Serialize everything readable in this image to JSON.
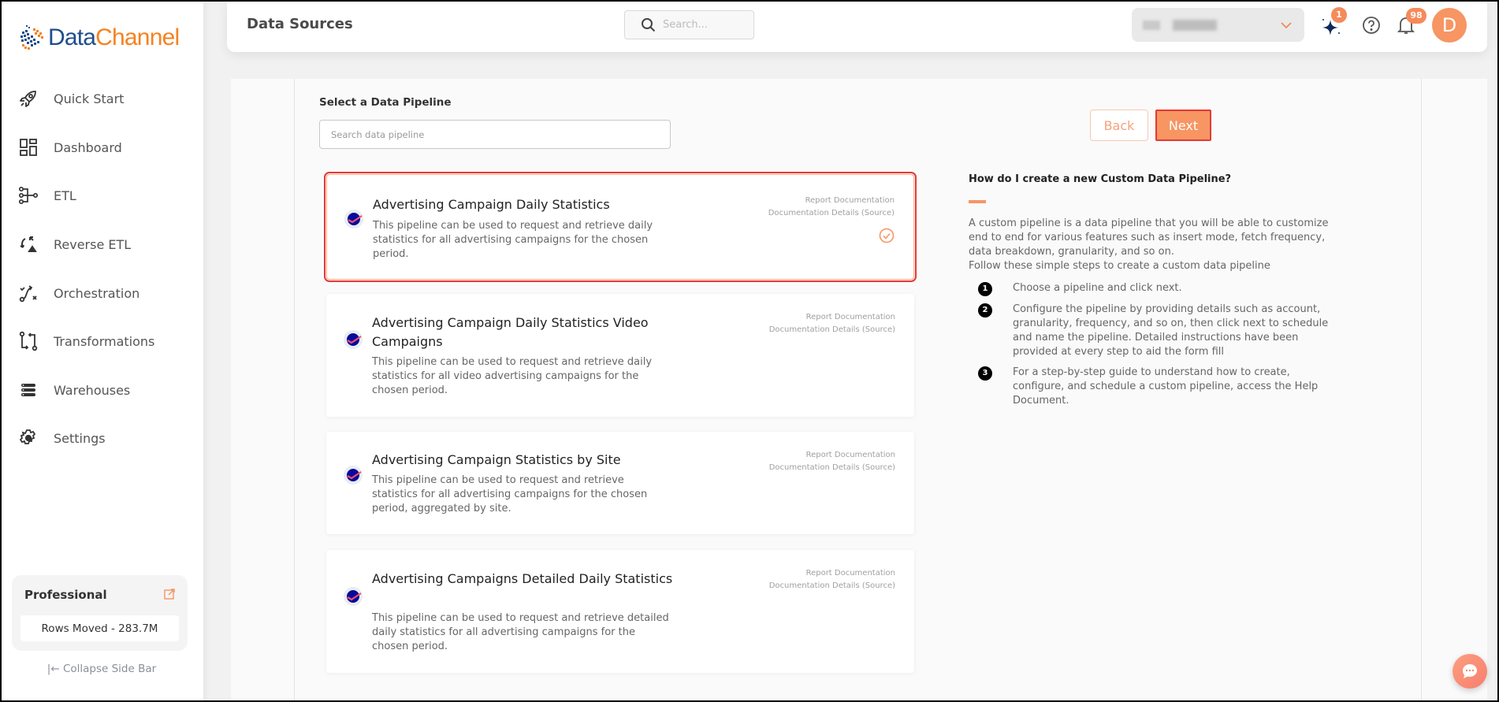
{
  "brand": {
    "name_part1": "Data",
    "name_part2": "Channel"
  },
  "sidebar": {
    "items": [
      {
        "label": "Quick Start",
        "icon": "rocket-icon"
      },
      {
        "label": "Dashboard",
        "icon": "dashboard-grid-icon"
      },
      {
        "label": "ETL",
        "icon": "etl-icon"
      },
      {
        "label": "Reverse ETL",
        "icon": "reverse-etl-icon"
      },
      {
        "label": "Orchestration",
        "icon": "orchestration-icon"
      },
      {
        "label": "Transformations",
        "icon": "transformations-icon"
      },
      {
        "label": "Warehouses",
        "icon": "warehouses-icon"
      },
      {
        "label": "Settings",
        "icon": "gear-icon"
      }
    ],
    "plan": {
      "name": "Professional",
      "rows_moved": "Rows Moved - 283.7M"
    },
    "collapse_label": "|← Collapse Side Bar"
  },
  "header": {
    "title": "Data Sources",
    "search_placeholder": "Search...",
    "workspace": {
      "value": "(blurred)"
    },
    "sparkle_badge": "1",
    "notifications_badge": "98",
    "avatar_initial": "D"
  },
  "main": {
    "section_label": "Select a Data Pipeline",
    "search_placeholder": "Search data pipeline",
    "back_label": "Back",
    "next_label": "Next",
    "pipelines": [
      {
        "title": "Advertising Campaign Daily Statistics",
        "description": "This pipeline can be used to request and retrieve daily statistics for all advertising campaigns for the chosen period.",
        "link1": "Report Documentation",
        "link2": "Documentation Details (Source)",
        "selected": true
      },
      {
        "title": "Advertising Campaign Daily Statistics Video Campaigns",
        "description": "This pipeline can be used to request and retrieve daily statistics for all video advertising campaigns for the chosen period.",
        "link1": "Report Documentation",
        "link2": "Documentation Details (Source)",
        "selected": false
      },
      {
        "title": "Advertising Campaign Statistics by Site",
        "description": "This pipeline can be used to request and retrieve statistics for all advertising campaigns for the chosen period, aggregated by site.",
        "link1": "Report Documentation",
        "link2": "Documentation Details (Source)",
        "selected": false
      },
      {
        "title": "Advertising Campaigns Detailed Daily Statistics",
        "description": "This pipeline can be used to request and retrieve detailed daily statistics for all advertising campaigns for the chosen period.",
        "link1": "Report Documentation",
        "link2": "Documentation Details (Source)",
        "selected": false
      }
    ]
  },
  "help": {
    "title": "How do I create a new Custom Data Pipeline?",
    "intro": "A custom pipeline is a data pipeline that you will be able to customize end to end for various features such as insert mode, fetch frequency, data breakdown, granularity, and so on.",
    "intro2": "Follow these simple steps to create a custom data pipeline",
    "steps": [
      {
        "num": "1",
        "text": "Choose a pipeline and click next."
      },
      {
        "num": "2",
        "text": "Configure the pipeline by providing details such as account, granularity, frequency, and so on, then click next to schedule and name the pipeline. Detailed instructions have been provided at every step to aid the form fill"
      },
      {
        "num": "3",
        "text": "For a step-by-step guide to understand how to create, configure, and schedule a custom pipeline, access the Help Document."
      }
    ]
  },
  "colors": {
    "accent": "#f79563",
    "brand_blue": "#1f4e8c",
    "brand_orange": "#f58220",
    "selection_outline": "#e53935"
  }
}
